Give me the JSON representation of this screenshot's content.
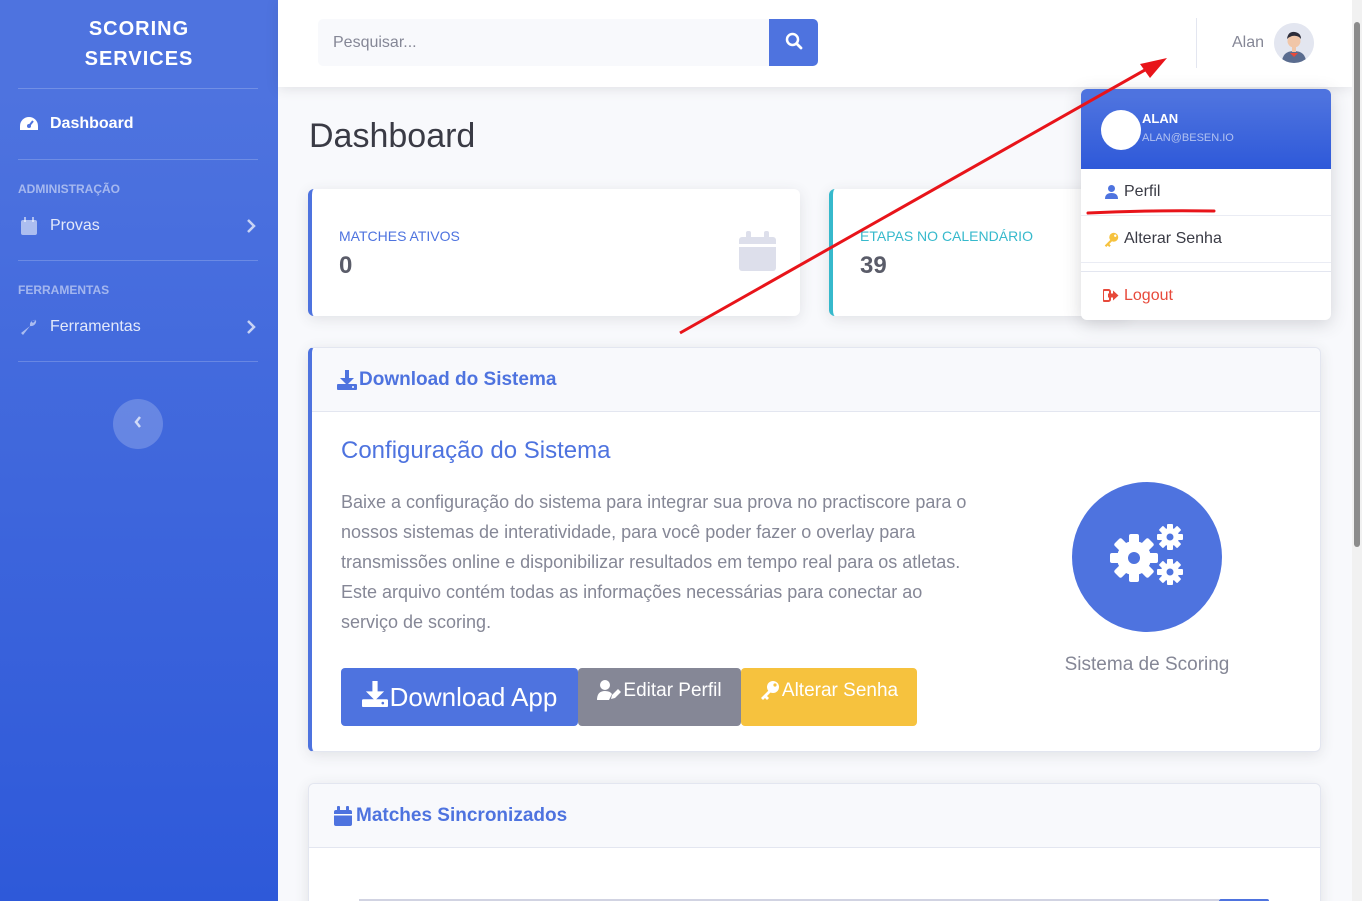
{
  "sidebar": {
    "brand_line1": "SCORING",
    "brand_line2": "SERVICES",
    "dashboard_label": "Dashboard",
    "heading_admin": "ADMINISTRAÇÃO",
    "provas_label": "Provas",
    "heading_tools": "FERRAMENTAS",
    "ferramentas_label": "Ferramentas",
    "icons": {
      "dashboard": "tachometer-icon",
      "provas": "calendar-icon",
      "ferramentas": "wrench-icon",
      "toggle": "chevron-left-icon"
    }
  },
  "topbar": {
    "search_placeholder": "Pesquisar...",
    "user_name": "Alan"
  },
  "page": {
    "title": "Dashboard"
  },
  "stats": [
    {
      "label": "MATCHES ATIVOS",
      "value": "0",
      "color": "#4e73df"
    },
    {
      "label": "ETAPAS NO CALENDÁRIO",
      "value": "39",
      "color": "#36b9cc"
    }
  ],
  "download_card": {
    "header": "Download do Sistema",
    "title": "Configuração do Sistema",
    "text": "Baixe a configuração do sistema para integrar sua prova no practiscore para o nossos sistemas de interatividade, para você poder fazer o overlay para transmissões online e disponibilizar resultados em tempo real para os atletas. Este arquivo contém todas as informações necessárias para conectar ao serviço de scoring.",
    "btn_download": "Download App",
    "btn_edit": "Editar Perfil",
    "btn_password": "Alterar Senha",
    "circle_label": "Sistema de Scoring"
  },
  "matches_card": {
    "header": "Matches Sincronizados"
  },
  "dropdown": {
    "name": "ALAN",
    "email": "ALAN@BESEN.IO",
    "perfil": "Perfil",
    "alterar_senha": "Alterar Senha",
    "logout": "Logout"
  },
  "colors": {
    "primary": "#4e73df",
    "info": "#36b9cc",
    "secondary": "#858796",
    "warning": "#f6c23e",
    "danger": "#e74a3b",
    "annotation": "#e8141a"
  }
}
